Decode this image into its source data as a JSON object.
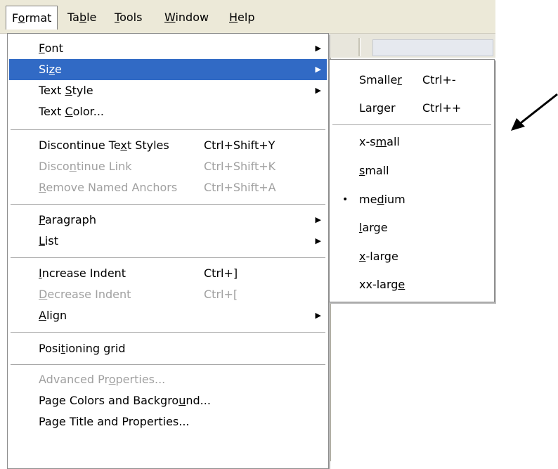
{
  "menubar": {
    "items": [
      {
        "pre": "F",
        "u": "o",
        "post": "rmat"
      },
      {
        "pre": "Ta",
        "u": "b",
        "post": "le"
      },
      {
        "pre": "",
        "u": "T",
        "post": "ools"
      },
      {
        "pre": "",
        "u": "W",
        "post": "indow"
      },
      {
        "pre": "",
        "u": "H",
        "post": "elp"
      }
    ]
  },
  "format_menu": {
    "items": [
      {
        "pre": "",
        "u": "F",
        "post": "ont",
        "shortcut": "",
        "submenu": true
      },
      {
        "pre": "Si",
        "u": "z",
        "post": "e",
        "shortcut": "",
        "submenu": true
      },
      {
        "pre": "Text ",
        "u": "S",
        "post": "tyle",
        "shortcut": "",
        "submenu": true
      },
      {
        "pre": "Text ",
        "u": "C",
        "post": "olor...",
        "shortcut": "",
        "submenu": false
      },
      {
        "pre": "Discontinue Te",
        "u": "x",
        "post": "t Styles",
        "shortcut": "Ctrl+Shift+Y",
        "submenu": false
      },
      {
        "pre": "Disco",
        "u": "n",
        "post": "tinue Link",
        "shortcut": "Ctrl+Shift+K",
        "submenu": false
      },
      {
        "pre": "",
        "u": "R",
        "post": "emove Named Anchors",
        "shortcut": "Ctrl+Shift+A",
        "submenu": false
      },
      {
        "pre": "",
        "u": "P",
        "post": "aragraph",
        "shortcut": "",
        "submenu": true
      },
      {
        "pre": "",
        "u": "L",
        "post": "ist",
        "shortcut": "",
        "submenu": true
      },
      {
        "pre": "",
        "u": "I",
        "post": "ncrease Indent",
        "shortcut": "Ctrl+]",
        "submenu": false
      },
      {
        "pre": "",
        "u": "D",
        "post": "ecrease Indent",
        "shortcut": "Ctrl+[",
        "submenu": false
      },
      {
        "pre": "",
        "u": "A",
        "post": "lign",
        "shortcut": "",
        "submenu": true
      },
      {
        "pre": "Posi",
        "u": "t",
        "post": "ioning grid",
        "shortcut": "",
        "submenu": false
      },
      {
        "pre": "Advanced Pr",
        "u": "o",
        "post": "perties...",
        "shortcut": "",
        "submenu": false
      },
      {
        "pre": "Page Colors and Backgro",
        "u": "u",
        "post": "nd...",
        "shortcut": "",
        "submenu": false
      },
      {
        "pre": "Page Title and Properties...",
        "u": "",
        "post": "",
        "shortcut": "",
        "submenu": false
      }
    ]
  },
  "size_submenu": {
    "items": [
      {
        "pre": "Smalle",
        "u": "r",
        "post": "",
        "shortcut": "Ctrl+-",
        "bullet": ""
      },
      {
        "pre": "Lar",
        "u": "g",
        "post": "er",
        "shortcut": "Ctrl++",
        "bullet": ""
      },
      {
        "pre": "x-s",
        "u": "m",
        "post": "all",
        "shortcut": "",
        "bullet": ""
      },
      {
        "pre": "",
        "u": "s",
        "post": "mall",
        "shortcut": "",
        "bullet": ""
      },
      {
        "pre": "me",
        "u": "d",
        "post": "ium",
        "shortcut": "",
        "bullet": "•"
      },
      {
        "pre": "",
        "u": "l",
        "post": "arge",
        "shortcut": "",
        "bullet": ""
      },
      {
        "pre": "",
        "u": "x",
        "post": "-large",
        "shortcut": "",
        "bullet": ""
      },
      {
        "pre": "xx-larg",
        "u": "e",
        "post": "",
        "shortcut": "",
        "bullet": ""
      }
    ]
  },
  "colors": {
    "highlight": "#316ac5",
    "disabled": "#a0a0a0",
    "menubar": "#ece9d8"
  }
}
